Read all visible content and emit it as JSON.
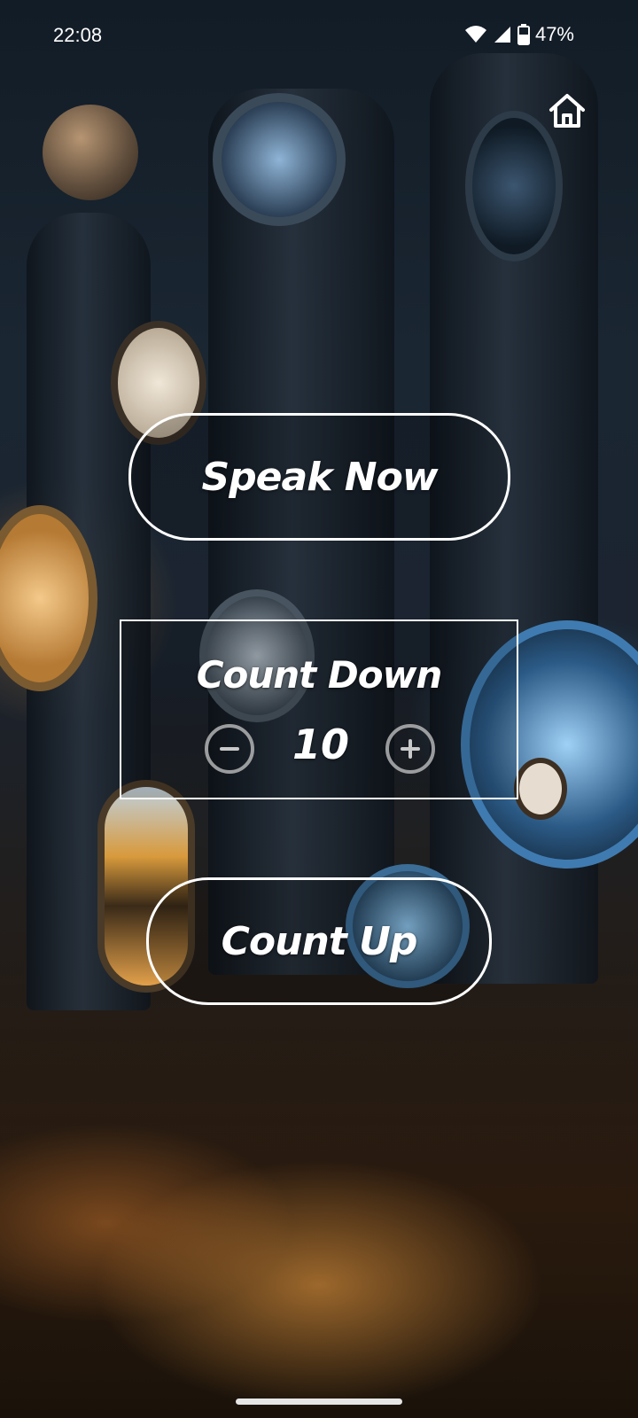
{
  "status_bar": {
    "time": "22:08",
    "battery": "47%",
    "icons": [
      "wifi-icon",
      "cell-signal-icon",
      "battery-icon"
    ]
  },
  "home_icon": "home-icon",
  "buttons": {
    "speak_now": "Speak Now",
    "count_up": "Count Up"
  },
  "countdown": {
    "label": "Count Down",
    "value": "10",
    "decrement_icon": "minus-circle-icon",
    "increment_icon": "plus-circle-icon"
  },
  "colors": {
    "text": "#ffffff",
    "stepper": "#c8c8c8"
  }
}
